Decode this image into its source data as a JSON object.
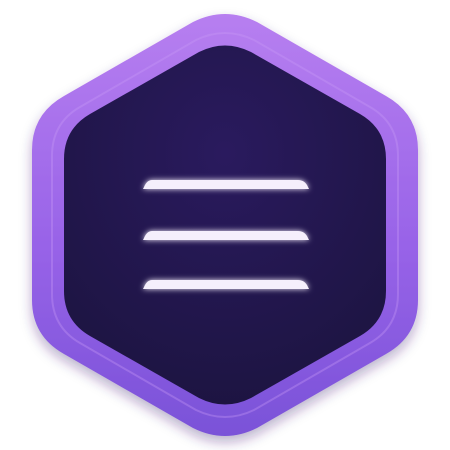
{
  "icon": {
    "name": "hexagon-menu-app-icon",
    "glyph": "hamburger-menu-icon",
    "colors": {
      "background": "#ffffff",
      "frame_light": "#b77ff0",
      "frame_mid": "#9863e8",
      "frame_dark": "#7a52d8",
      "inner_top": "#2a1a5e",
      "inner_bottom": "#1c1440",
      "bar_color": "#f5effc",
      "bar_glow": "#c9a8ff"
    },
    "menu_bar_count": 3
  }
}
